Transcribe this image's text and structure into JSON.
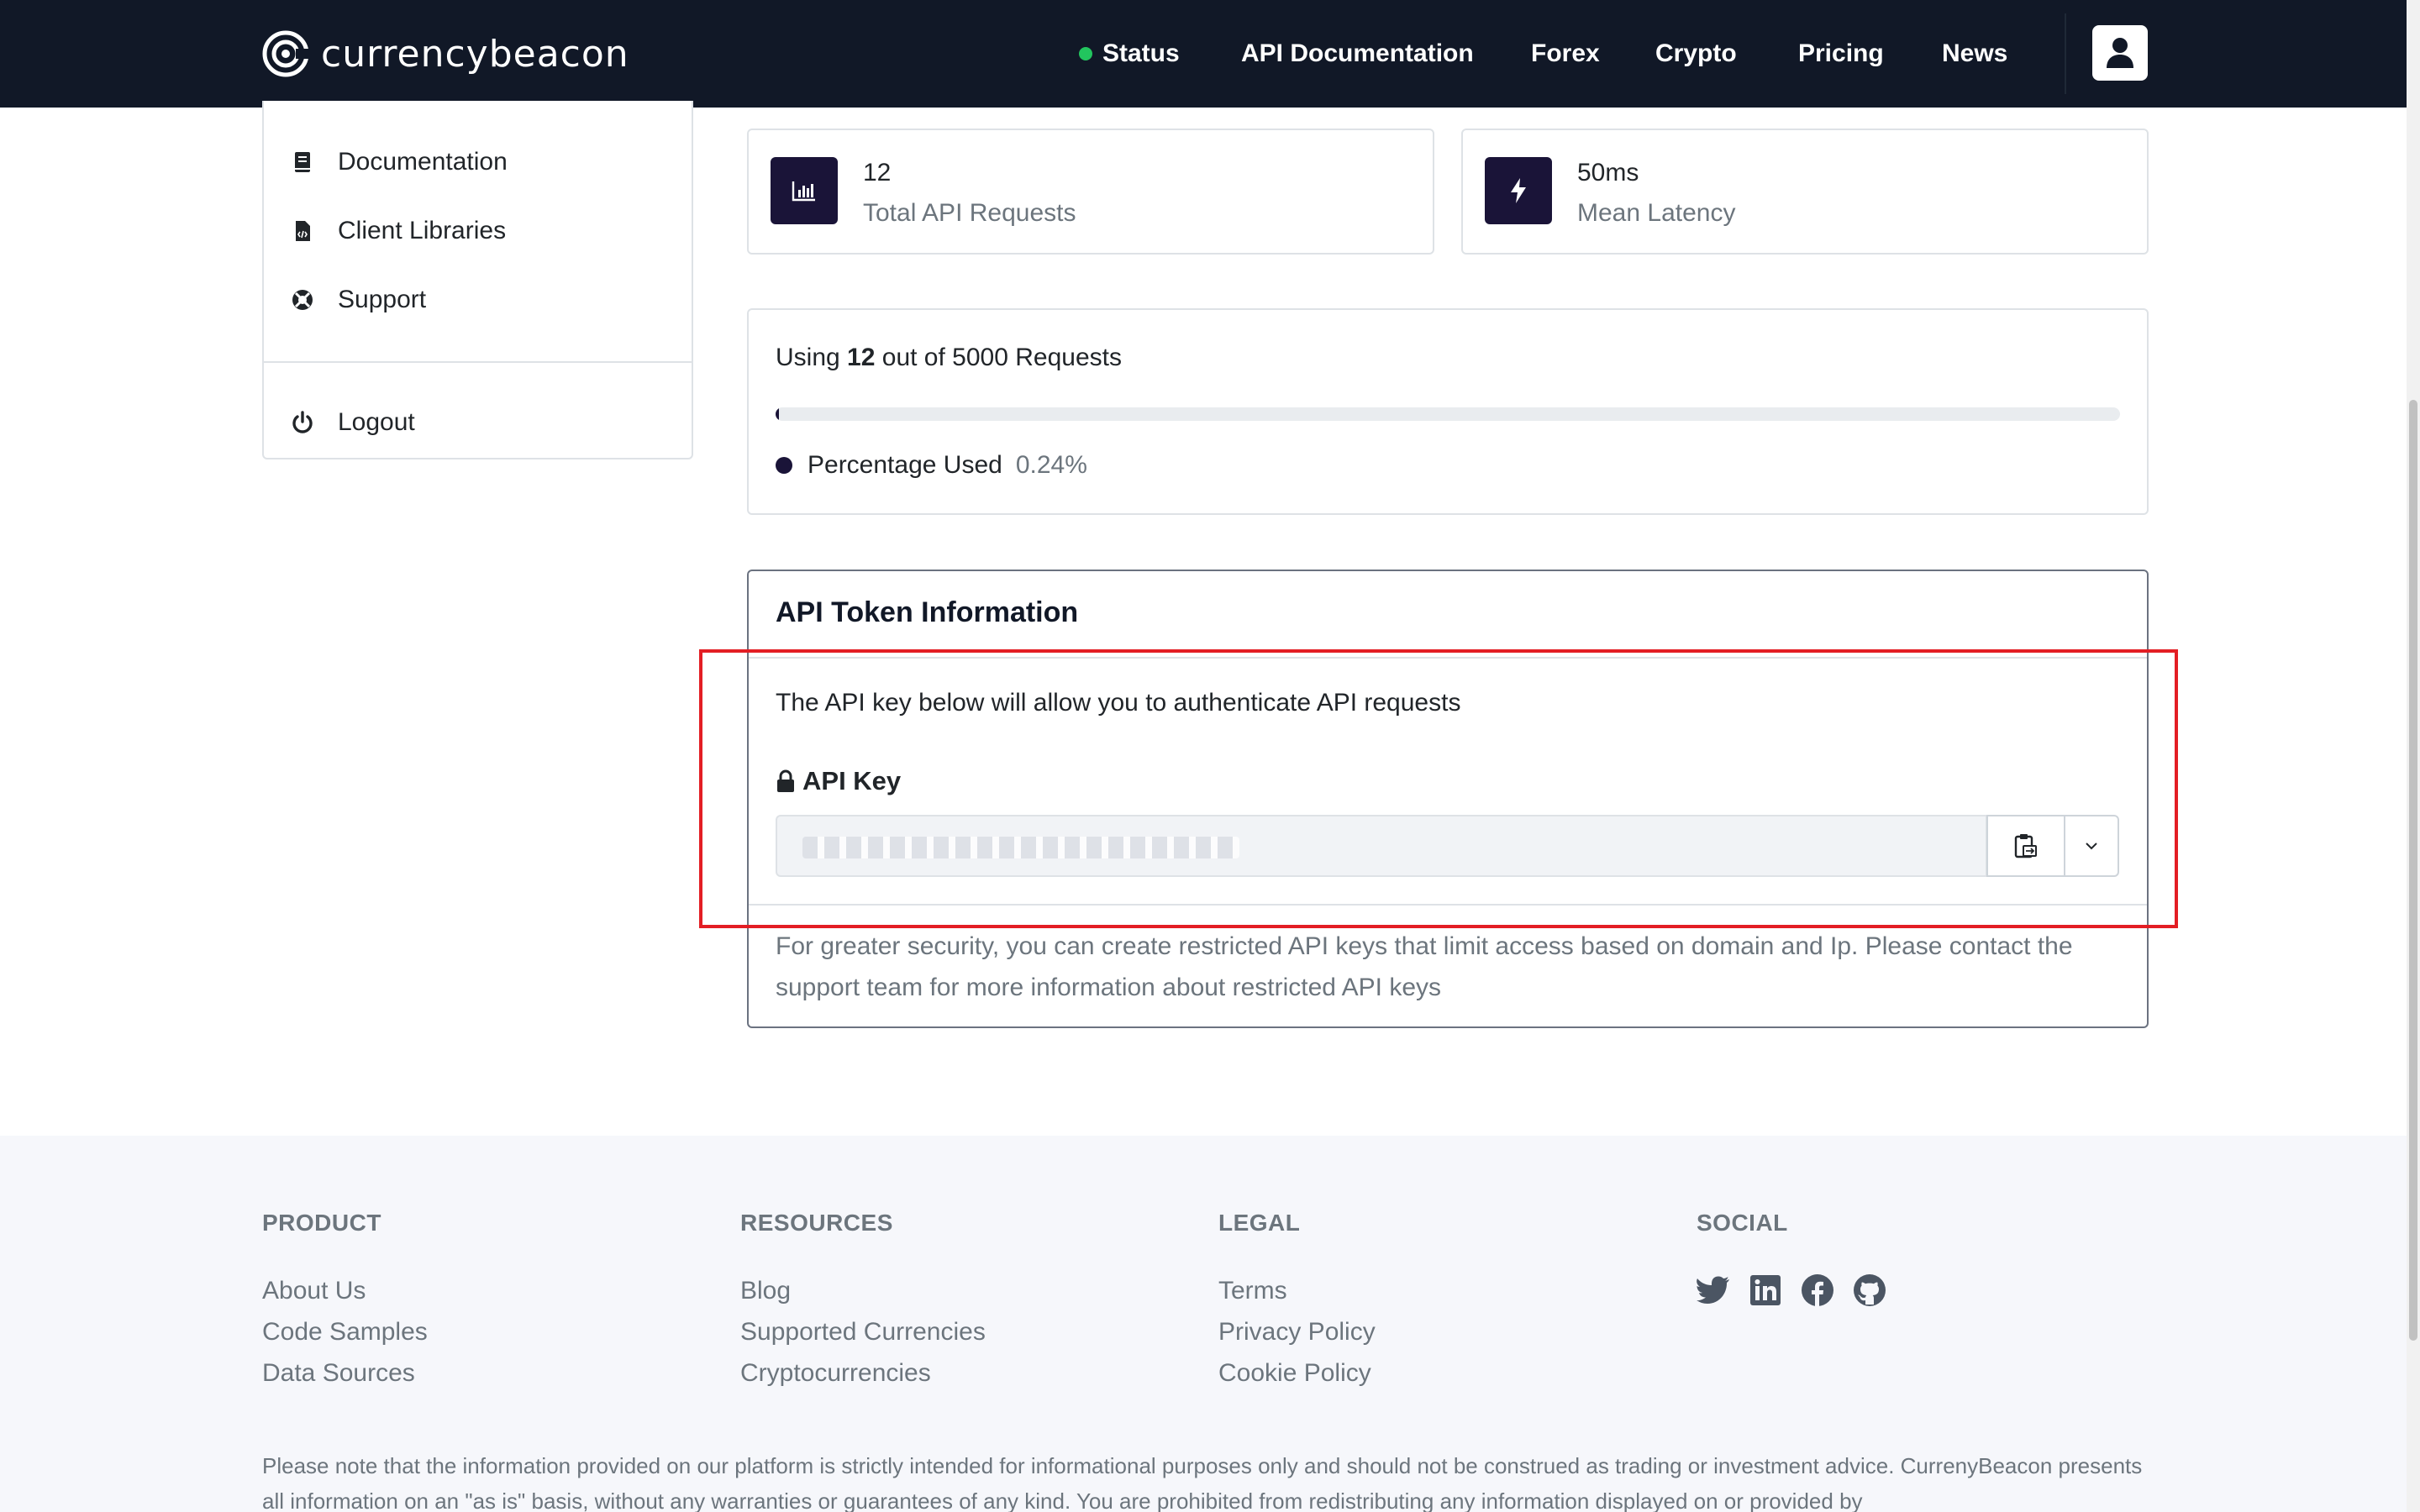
{
  "header": {
    "brand": "currencybeacon",
    "nav": [
      {
        "label": "Status"
      },
      {
        "label": "API Documentation"
      },
      {
        "label": "Forex"
      },
      {
        "label": "Crypto"
      },
      {
        "label": "Pricing"
      },
      {
        "label": "News"
      }
    ]
  },
  "sidebar": {
    "items": [
      {
        "label": "Documentation",
        "icon": "book-icon"
      },
      {
        "label": "Client Libraries",
        "icon": "code-file-icon"
      },
      {
        "label": "Support",
        "icon": "lifebuoy-icon"
      }
    ],
    "logout": {
      "label": "Logout",
      "icon": "power-icon"
    }
  },
  "stats": [
    {
      "value": "12",
      "label": "Total API Requests",
      "icon": "chart-icon"
    },
    {
      "value": "50ms",
      "label": "Mean Latency",
      "icon": "bolt-icon"
    }
  ],
  "usage": {
    "prefix": "Using",
    "used": "12",
    "middle": "out of",
    "limit": "5000",
    "suffix": "Requests",
    "percent_label": "Percentage Used",
    "percent_value": "0.24%",
    "fraction": 0.0024
  },
  "token": {
    "title": "API Token Information",
    "description": "The API key below will allow you to authenticate API requests",
    "key_label": "API Key",
    "note": "For greater security, you can create restricted API keys that limit access based on domain and Ip. Please contact the support team for more information about restricted API keys"
  },
  "footer": {
    "columns": [
      {
        "heading": "PRODUCT",
        "links": [
          "About Us",
          "Code Samples",
          "Data Sources"
        ]
      },
      {
        "heading": "RESOURCES",
        "links": [
          "Blog",
          "Supported Currencies",
          "Cryptocurrencies"
        ]
      },
      {
        "heading": "LEGAL",
        "links": [
          "Terms",
          "Privacy Policy",
          "Cookie Policy"
        ]
      }
    ],
    "social": {
      "heading": "SOCIAL",
      "icons": [
        "twitter-icon",
        "linkedin-icon",
        "facebook-icon",
        "github-icon"
      ]
    },
    "disclaimer": "Please note that the information provided on our platform is strictly intended for informational purposes only and should not be construed as trading or investment advice. CurrenyBeacon presents all information on an \"as is\" basis, without any warranties or guarantees of any kind. You are prohibited from redistributing any information displayed on or provided by"
  },
  "colors": {
    "header_bg": "#111827",
    "accent": "#1a1438",
    "status_green": "#22c55e",
    "highlight_red": "#e31e24"
  }
}
